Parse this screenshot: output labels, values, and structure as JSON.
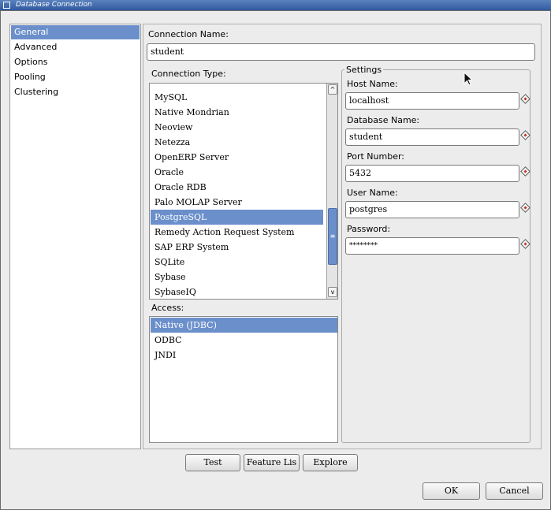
{
  "window": {
    "title": "Database Connection"
  },
  "nav": {
    "items": [
      "General",
      "Advanced",
      "Options",
      "Pooling",
      "Clustering"
    ],
    "selected": "General"
  },
  "connection_name": {
    "label": "Connection Name:",
    "value": "student"
  },
  "connection_type": {
    "label": "Connection Type:",
    "items": [
      "MySQL",
      "Native Mondrian",
      "Neoview",
      "Netezza",
      "OpenERP Server",
      "Oracle",
      "Oracle RDB",
      "Palo MOLAP Server",
      "PostgreSQL",
      "Remedy Action Request System",
      "SAP ERP System",
      "SQLite",
      "Sybase",
      "SybaseIQ"
    ],
    "selected": "PostgreSQL"
  },
  "access": {
    "label": "Access:",
    "items": [
      "Native (JDBC)",
      "ODBC",
      "JNDI"
    ],
    "selected": "Native (JDBC)"
  },
  "settings": {
    "title": "Settings",
    "host": {
      "label": "Host Name:",
      "value": "localhost"
    },
    "database": {
      "label": "Database Name:",
      "value": "student"
    },
    "port": {
      "label": "Port Number:",
      "value": "5432"
    },
    "user": {
      "label": "User Name:",
      "value": "postgres"
    },
    "password": {
      "label": "Password:",
      "value": "********"
    }
  },
  "buttons": {
    "test": "Test",
    "feature_list": "Feature Lis",
    "explore": "Explore",
    "ok": "OK",
    "cancel": "Cancel"
  },
  "colors": {
    "selection": "#6b8fcb",
    "titlebar": "#2f5aa0",
    "required": "#c0392b"
  }
}
